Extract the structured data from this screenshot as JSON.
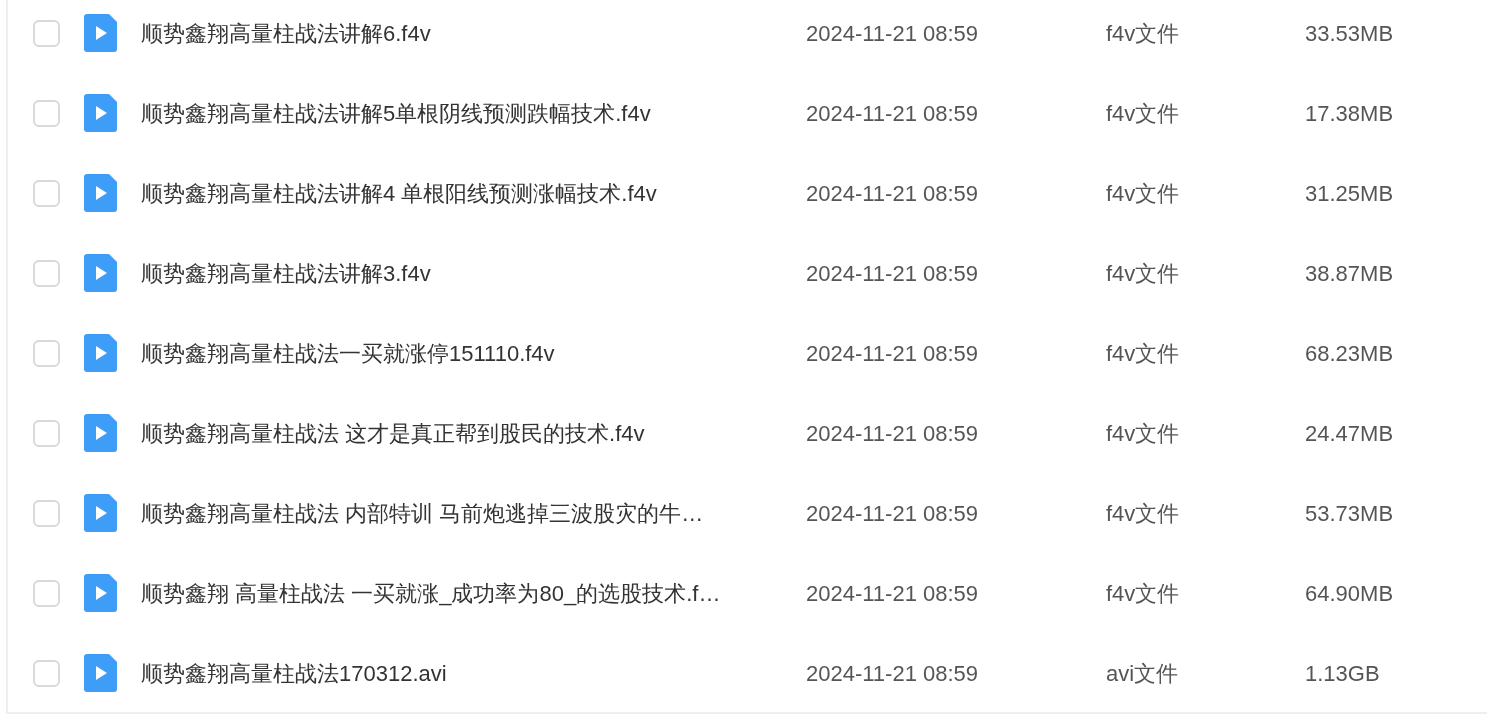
{
  "files": [
    {
      "name": "顺势鑫翔高量柱战法讲解6.f4v",
      "modified": "2024-11-21 08:59",
      "type": "f4v文件",
      "size": "33.53MB",
      "checked": false
    },
    {
      "name": "顺势鑫翔高量柱战法讲解5单根阴线预测跌幅技术.f4v",
      "modified": "2024-11-21 08:59",
      "type": "f4v文件",
      "size": "17.38MB",
      "checked": false
    },
    {
      "name": "顺势鑫翔高量柱战法讲解4 单根阳线预测涨幅技术.f4v",
      "modified": "2024-11-21 08:59",
      "type": "f4v文件",
      "size": "31.25MB",
      "checked": false
    },
    {
      "name": "顺势鑫翔高量柱战法讲解3.f4v",
      "modified": "2024-11-21 08:59",
      "type": "f4v文件",
      "size": "38.87MB",
      "checked": false
    },
    {
      "name": "顺势鑫翔高量柱战法一买就涨停151110.f4v",
      "modified": "2024-11-21 08:59",
      "type": "f4v文件",
      "size": "68.23MB",
      "checked": false
    },
    {
      "name": "顺势鑫翔高量柱战法 这才是真正帮到股民的技术.f4v",
      "modified": "2024-11-21 08:59",
      "type": "f4v文件",
      "size": "24.47MB",
      "checked": false
    },
    {
      "name": "顺势鑫翔高量柱战法 内部特训 马前炮逃掉三波股灾的牛…",
      "modified": "2024-11-21 08:59",
      "type": "f4v文件",
      "size": "53.73MB",
      "checked": false
    },
    {
      "name": "顺势鑫翔 高量柱战法 一买就涨_成功率为80_的选股技术.f…",
      "modified": "2024-11-21 08:59",
      "type": "f4v文件",
      "size": "64.90MB",
      "checked": false
    },
    {
      "name": "顺势鑫翔高量柱战法170312.avi",
      "modified": "2024-11-21 08:59",
      "type": "avi文件",
      "size": "1.13GB",
      "checked": false
    }
  ]
}
